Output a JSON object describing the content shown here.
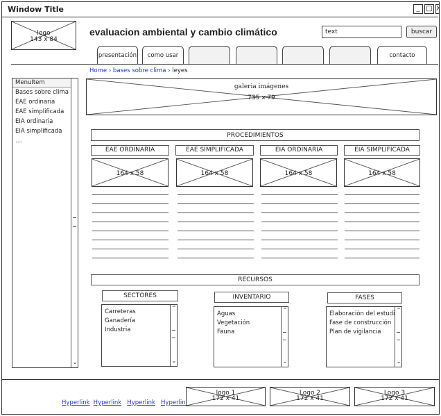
{
  "window": {
    "title": "Window Title",
    "controls": [
      "_",
      "□",
      "X"
    ]
  },
  "logo": {
    "label": "logo",
    "size": "143 x 84"
  },
  "header": {
    "title": "evaluacion ambiental y cambio climático",
    "search_value": "text",
    "search_button": "buscar"
  },
  "tabs": [
    {
      "label": "presentación"
    },
    {
      "label": "como usar"
    },
    {
      "label": ""
    },
    {
      "label": ""
    },
    {
      "label": ""
    },
    {
      "label": ""
    },
    {
      "label": "contacto"
    }
  ],
  "breadcrumb": {
    "home": "Home",
    "sep1": "›",
    "parent": "bases sobre clima",
    "sep2": "›",
    "current": "leyes"
  },
  "sidebar": {
    "header": "MenuItem",
    "items": [
      "Bases sobre clima",
      "EAE ordinaria",
      "EAE simplificada",
      "EIA ordinaria",
      "EIA simplificada",
      "...."
    ]
  },
  "gallery": {
    "label": "galeria imágenes",
    "size": "735 x 79"
  },
  "procedimientos": {
    "title": "PROCEDIMIENTOS",
    "columns": [
      {
        "label": "EAE ORDINARIA",
        "img": "164 x 58"
      },
      {
        "label": "EAE SIMPLIFICADA",
        "img": "164 x 58"
      },
      {
        "label": "EIA ORDINARIA",
        "img": "164 x 58"
      },
      {
        "label": "EIA SIMPLIFICADA",
        "img": "164 x 58"
      }
    ]
  },
  "recursos": {
    "title": "RECURSOS",
    "lists": [
      {
        "title": "SECTORES",
        "items": [
          "Carreteras",
          "Ganadería",
          "Industria"
        ]
      },
      {
        "title": "INVENTARIO",
        "items": [
          "Aguas",
          "Vegetación",
          "Fauna"
        ]
      },
      {
        "title": "FASES",
        "items": [
          "Elaboración del estudio",
          "Fase de construcción",
          "Plan de vigilancia"
        ]
      }
    ]
  },
  "footer": {
    "links": [
      "Hyperlink",
      "Hyperlink",
      "Hyperlink",
      "Hyperlink"
    ],
    "logos": [
      {
        "label": "logo 1",
        "size": "172 x 41"
      },
      {
        "label": "Logo 2",
        "size": "172 x 41"
      },
      {
        "label": "Logo 3",
        "size": "172 x 41"
      }
    ]
  }
}
